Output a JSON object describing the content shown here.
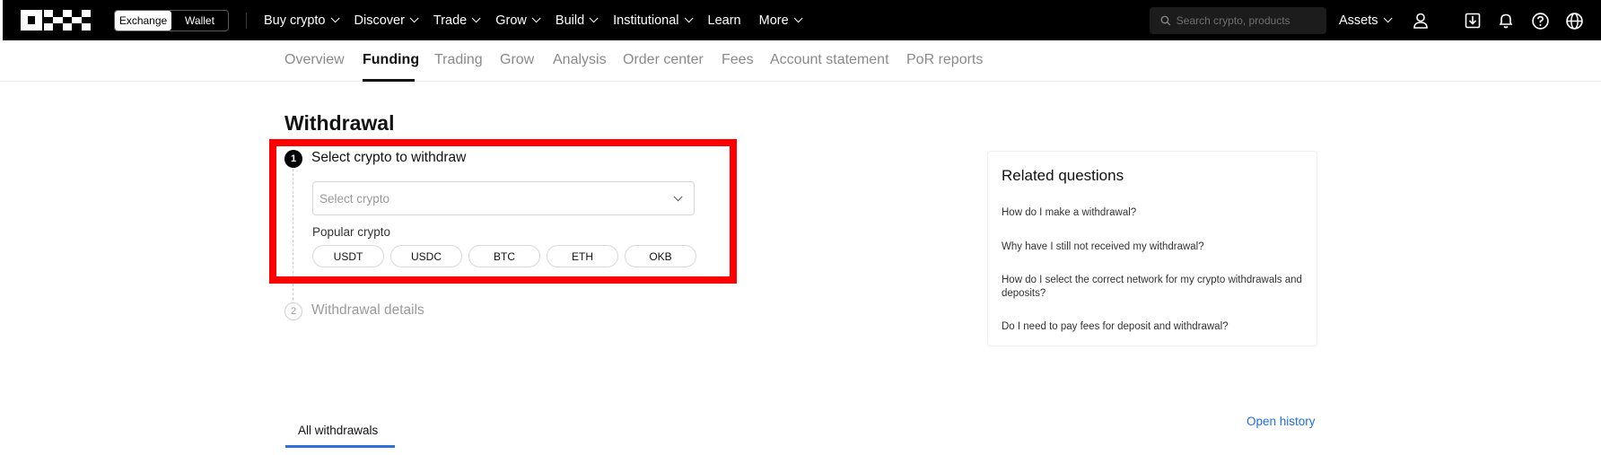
{
  "topbar": {
    "mode_toggle": {
      "exchange": "Exchange",
      "wallet": "Wallet"
    },
    "nav": [
      {
        "label": "Buy crypto",
        "dropdown": true
      },
      {
        "label": "Discover",
        "dropdown": true
      },
      {
        "label": "Trade",
        "dropdown": true
      },
      {
        "label": "Grow",
        "dropdown": true
      },
      {
        "label": "Build",
        "dropdown": true
      },
      {
        "label": "Institutional",
        "dropdown": true
      },
      {
        "label": "Learn",
        "dropdown": false
      },
      {
        "label": "More",
        "dropdown": true
      }
    ],
    "search_placeholder": "Search crypto, products",
    "assets_label": "Assets",
    "icons": [
      "user-icon",
      "download-app-icon",
      "bell-icon",
      "help-icon",
      "globe-icon"
    ]
  },
  "subnav": {
    "tabs": [
      "Overview",
      "Funding",
      "Trading",
      "Grow",
      "Analysis",
      "Order center",
      "Fees",
      "Account statement",
      "PoR reports"
    ],
    "active": "Funding"
  },
  "withdrawal": {
    "title": "Withdrawal",
    "step1": {
      "number": "1",
      "title": "Select crypto to withdraw"
    },
    "select_placeholder": "Select crypto",
    "popular_label": "Popular crypto",
    "popular": [
      "USDT",
      "USDC",
      "BTC",
      "ETH",
      "OKB"
    ],
    "step2": {
      "number": "2",
      "title": "Withdrawal details"
    }
  },
  "related": {
    "title": "Related questions",
    "questions": [
      "How do I make a withdrawal?",
      "Why have I still not received my withdrawal?",
      "How do I select the correct network for my crypto withdrawals and deposits?",
      "Do I need to pay fees for deposit and withdrawal?"
    ]
  },
  "history": {
    "tab": "All withdrawals",
    "open_history": "Open history"
  },
  "colors": {
    "highlight": "#ff0000",
    "link": "#1f6fe5",
    "topbar": "#000000"
  }
}
